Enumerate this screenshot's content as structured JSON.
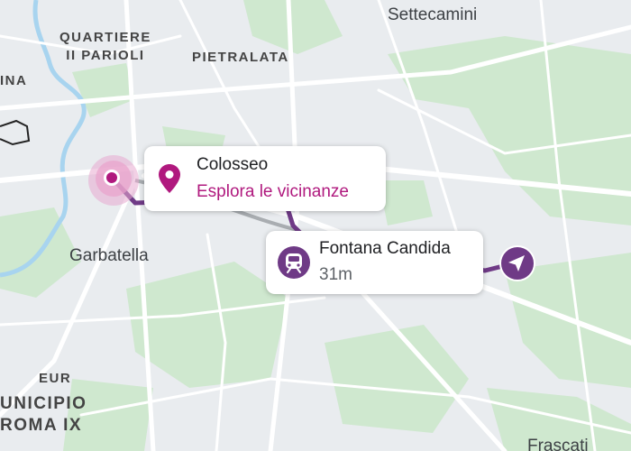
{
  "map": {
    "labels": {
      "settecamini": "Settecamini",
      "quartiere_line1": "QUARTIERE",
      "quartiere_line2": "II PARIOLI",
      "pietralata": "PIETRALATA",
      "ina": "INA",
      "garbatella": "Garbatella",
      "eur": "EUR",
      "municipio_line1": "UNICIPIO",
      "municipio_line2": "ROMA IX",
      "frascati": "Frascati"
    },
    "colors": {
      "land": "#e9ecef",
      "park": "#cfe8cf",
      "road": "#ffffff",
      "route": "#6f3a86",
      "pin": "#b0197e",
      "river": "#a8d4ef"
    }
  },
  "origin_card": {
    "icon": "location-pin-icon",
    "title": "Colosseo",
    "subtitle": "Esplora le vicinanze"
  },
  "destination_card": {
    "icon": "metro-train-icon",
    "title": "Fontana Candida",
    "subtitle": "31m"
  },
  "navigation_marker": {
    "icon": "navigation-arrow-icon"
  }
}
